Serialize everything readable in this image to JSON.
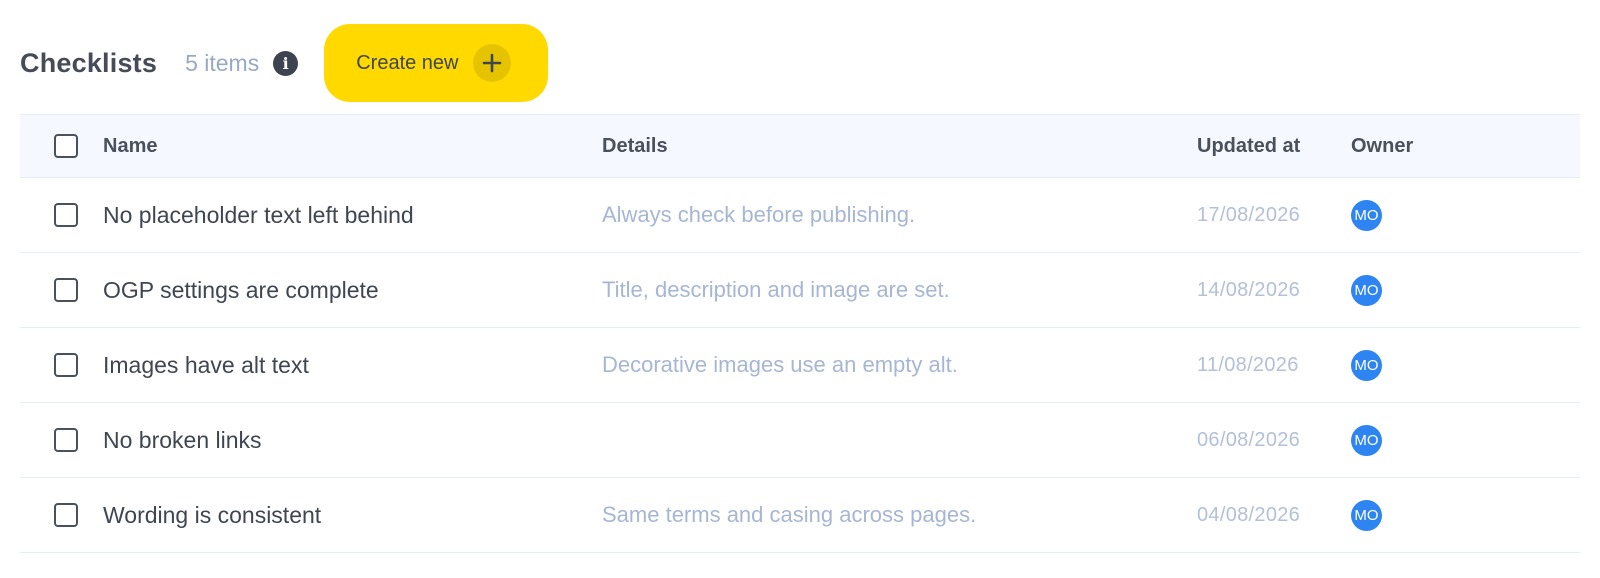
{
  "header": {
    "title": "Checklists",
    "count": "5 items",
    "info_icon": "info-icon",
    "create_label": "Create new",
    "create_icon": "plus-icon"
  },
  "colors": {
    "accent": "#ffd900",
    "avatar": "#2e85f2",
    "muted_text": "#a6b6d3",
    "header_bg": "#f5f9ff"
  },
  "table": {
    "columns": [
      "Name",
      "Details",
      "Updated at",
      "Owner"
    ],
    "rows": [
      {
        "name": "No placeholder text left behind",
        "details": "Always check before publishing.",
        "updated": "17/08/2026",
        "owner": "MO"
      },
      {
        "name": "OGP settings are complete",
        "details": "Title, description and image are set.",
        "updated": "14/08/2026",
        "owner": "MO"
      },
      {
        "name": "Images have alt text",
        "details": "Decorative images use an empty alt.",
        "updated": "11/08/2026",
        "owner": "MO"
      },
      {
        "name": "No broken links",
        "details": "",
        "updated": "06/08/2026",
        "owner": "MO"
      },
      {
        "name": "Wording is consistent",
        "details": "Same terms and casing across pages.",
        "updated": "04/08/2026",
        "owner": "MO"
      }
    ]
  }
}
